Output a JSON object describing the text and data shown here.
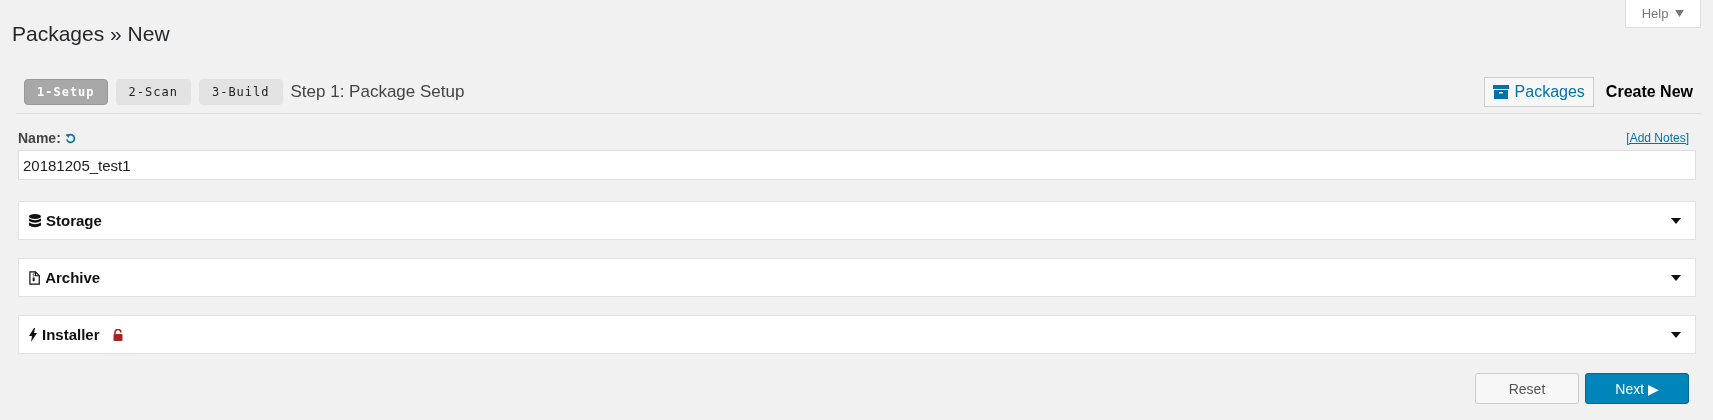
{
  "help_tab": {
    "label": "Help"
  },
  "page_title": "Packages » New",
  "steps": [
    {
      "label": "1-Setup",
      "selected": true
    },
    {
      "label": "2-Scan",
      "selected": false
    },
    {
      "label": "3-Build",
      "selected": false
    }
  ],
  "step_title": "Step 1: Package Setup",
  "nav": {
    "packages_button": "Packages",
    "current": "Create New"
  },
  "name_field": {
    "label": "Name:",
    "value": "20181205_test1",
    "add_notes_link": "[Add Notes]"
  },
  "panels": [
    {
      "kind": "storage",
      "title": "Storage",
      "expanded": false
    },
    {
      "kind": "archive",
      "title": "Archive",
      "expanded": false
    },
    {
      "kind": "installer",
      "title": "Installer",
      "expanded": false,
      "locked": false
    }
  ],
  "buttons": [
    {
      "kind": "secondary",
      "label": "Reset"
    },
    {
      "kind": "primary",
      "label": "Next ▶"
    }
  ]
}
